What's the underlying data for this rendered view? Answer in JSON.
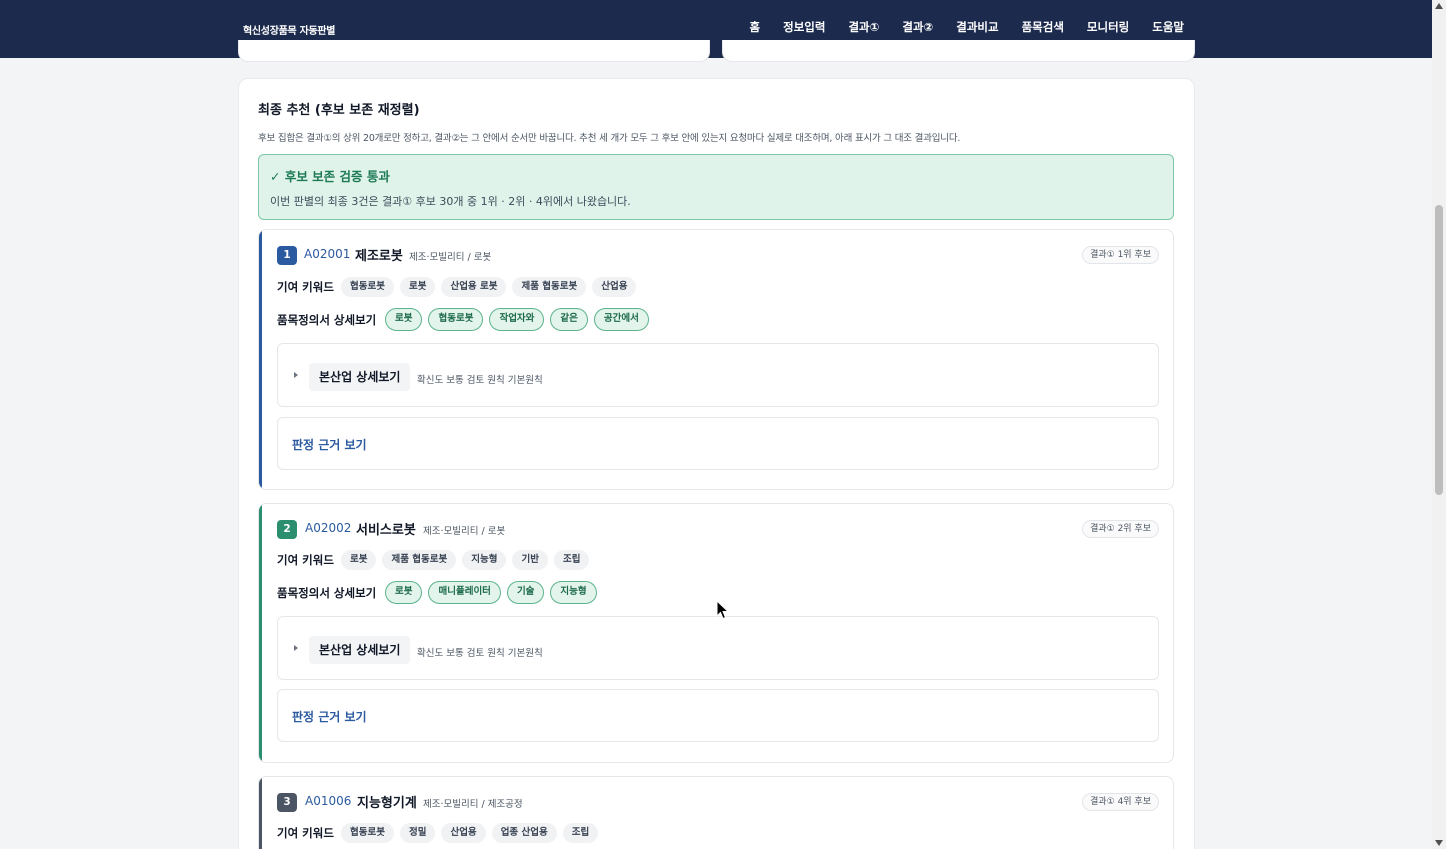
{
  "header": {
    "brand": "혁신성장품목 자동판별",
    "nav": [
      "홈",
      "정보입력",
      "결과①",
      "결과②",
      "결과비교",
      "품목검색",
      "모니터링",
      "도움말"
    ]
  },
  "section": {
    "title": "최종 추천 (후보 보존 재정렬)",
    "description": "후보 집합은 결과①의 상위 20개로만 정하고, 결과②는 그 안에서 순서만 바꿉니다. 추천 세 개가 모두 그 후보 안에 있는지 요청마다 실제로 대조하며, 아래 표시가 그 대조 결과입니다."
  },
  "alert": {
    "title": "✓ 후보 보존 검증 통과",
    "text": "이번 판별의 최종 3건은 결과① 후보 30개 중 1위 · 2위 · 4위에서 나왔습니다."
  },
  "colors": {
    "nav_bg": "#1c2a4d",
    "rank1": "#2c5aa0",
    "rank2": "#2b8f6f",
    "rank3": "#4b5563"
  },
  "labels": {
    "keywords": "기여 키워드",
    "definition": "품목정의서 상세보기",
    "industry_detail": "본산업 상세보기",
    "basis": "판정 근거 보기"
  },
  "recommendations": [
    {
      "rank": "1",
      "code": "A02001",
      "name": "제조로봇",
      "category": "제조·모빌리티 / 로봇",
      "badge": "결과① 1위 후보",
      "keywords": [
        "협동로봇",
        "로봇",
        "산업용 로봇",
        "제품 협동로봇",
        "산업용"
      ],
      "definition_terms": [
        "로봇",
        "협동로봇",
        "작업자와",
        "같은",
        "공간에서"
      ],
      "industry_meta": "확신도 보통   검토 원칙 기본원칙"
    },
    {
      "rank": "2",
      "code": "A02002",
      "name": "서비스로봇",
      "category": "제조·모빌리티 / 로봇",
      "badge": "결과① 2위 후보",
      "keywords": [
        "로봇",
        "제품 협동로봇",
        "지능형",
        "기반",
        "조립"
      ],
      "definition_terms": [
        "로봇",
        "매니퓰레이터",
        "기술",
        "지능형"
      ],
      "industry_meta": "확신도 보통   검토 원칙 기본원칙"
    },
    {
      "rank": "3",
      "code": "A01006",
      "name": "지능형기계",
      "category": "제조·모빌리티 / 제조공정",
      "badge": "결과① 4위 후보",
      "keywords": [
        "협동로봇",
        "정밀",
        "산업용",
        "업종 산업용",
        "조립"
      ],
      "definition_terms": [],
      "industry_meta": ""
    }
  ]
}
